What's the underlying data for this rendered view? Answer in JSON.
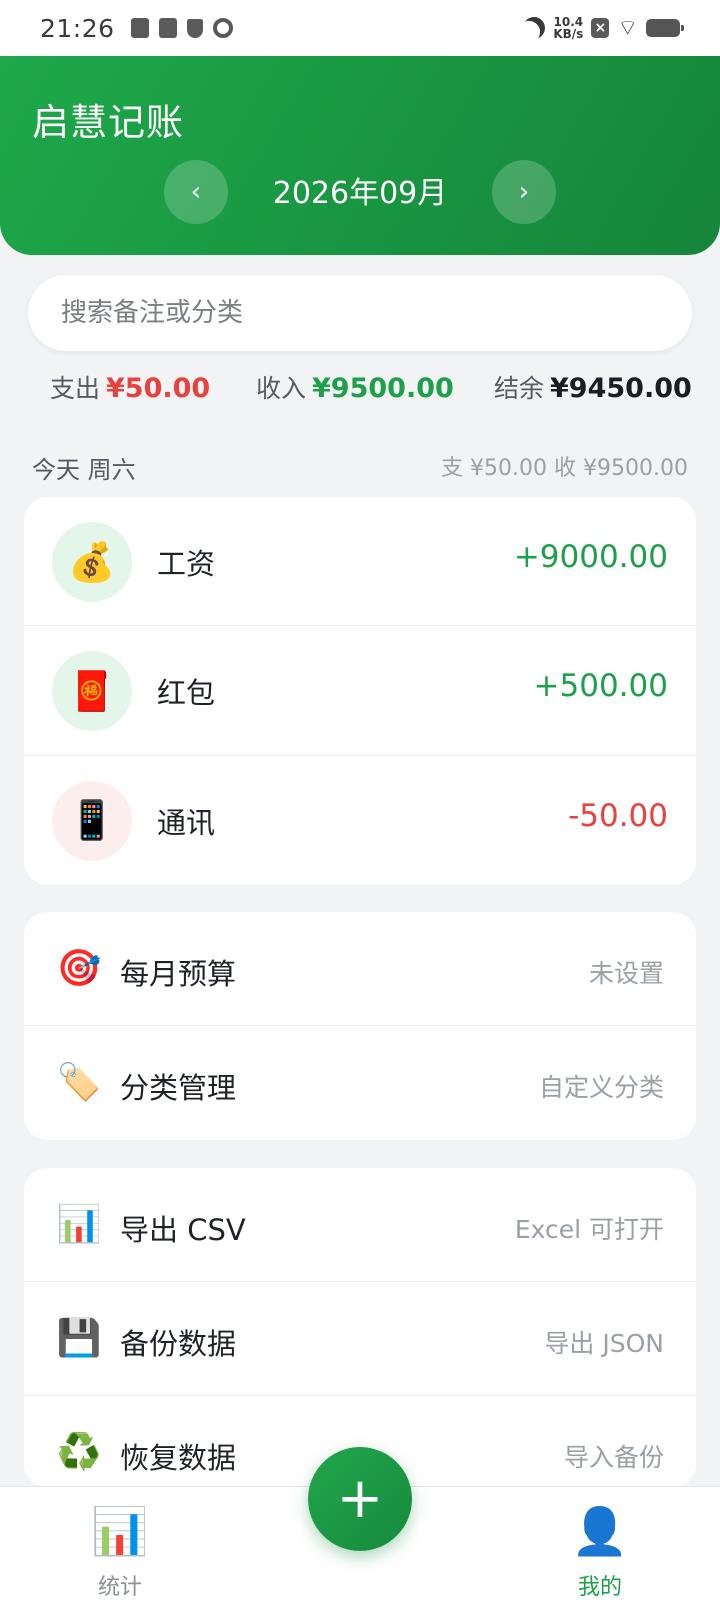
{
  "status_bar": {
    "time": "21:26",
    "net_speed_value": "10.4",
    "net_speed_unit": "KB/s"
  },
  "header": {
    "app_title": "启慧记账",
    "month": "2026年09月",
    "prev_icon": "‹",
    "next_icon": "›"
  },
  "search": {
    "placeholder": "搜索备注或分类"
  },
  "summary": {
    "expense_label": "支出",
    "expense_value": "¥50.00",
    "income_label": "收入",
    "income_value": "¥9500.00",
    "balance_label": "结余",
    "balance_value": "¥9450.00"
  },
  "day_group": {
    "label": "今天 周六",
    "totals": "支 ¥50.00 收 ¥9500.00"
  },
  "transactions": [
    {
      "icon": "💰",
      "name": "工资",
      "amount": "+9000.00",
      "type": "income"
    },
    {
      "icon": "🧧",
      "name": "红包",
      "amount": "+500.00",
      "type": "income"
    },
    {
      "icon": "📱",
      "name": "通讯",
      "amount": "-50.00",
      "type": "expense"
    }
  ],
  "menu_group_1": [
    {
      "icon": "🎯",
      "label": "每月预算",
      "hint": "未设置"
    },
    {
      "icon": "🏷️",
      "label": "分类管理",
      "hint": "自定义分类"
    }
  ],
  "menu_group_2": [
    {
      "icon": "📊",
      "label": "导出 CSV",
      "hint": "Excel 可打开"
    },
    {
      "icon": "💾",
      "label": "备份数据",
      "hint": "导出 JSON"
    },
    {
      "icon": "♻️",
      "label": "恢复数据",
      "hint": "导入备份"
    }
  ],
  "bottom_nav": {
    "stats_icon": "📊",
    "stats_label": "统计",
    "fab_icon": "+",
    "mine_icon": "👤",
    "mine_label": "我的"
  },
  "colors": {
    "primary_green": "#1ea04a",
    "expense_red": "#e8413e",
    "header_gradient_start": "#1ea84a",
    "header_gradient_end": "#15853a"
  }
}
